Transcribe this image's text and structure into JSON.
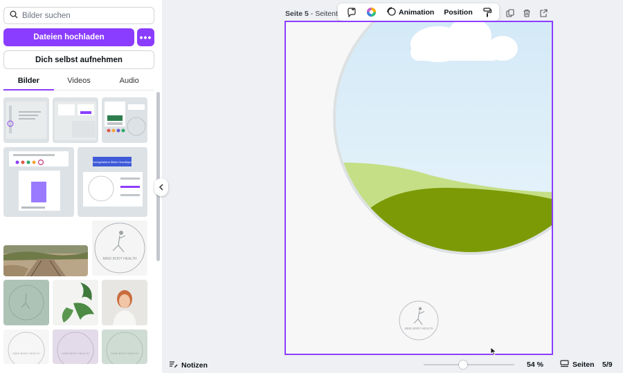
{
  "sidebar": {
    "search_placeholder": "Bilder suchen",
    "upload_label": "Dateien hochladen",
    "more_label": "•••",
    "record_label": "Dich selbst aufnehmen",
    "tabs": [
      {
        "label": "Bilder",
        "active": true
      },
      {
        "label": "Videos",
        "active": false
      },
      {
        "label": "Audio",
        "active": false
      }
    ],
    "thumb_button_label": "Hochgeladene Bilder hinzufügen",
    "thumb_logo_text": "MIND BODY HEALTH"
  },
  "canvas": {
    "page_label_bold": "Seite 5",
    "page_label_rest": " - Seitentit",
    "toolbar": {
      "animation_label": "Animation",
      "position_label": "Position"
    },
    "logo_text": "MIND BODY HEALTH"
  },
  "bottom_bar": {
    "notes_label": "Notizen",
    "zoom_label": "54 %",
    "pages_label": "Seiten",
    "pages_count": "5/9"
  },
  "colors": {
    "accent": "#8b3dff",
    "sky": "#cfe7f6",
    "light_green": "#c5df86",
    "dark_green": "#7c9a06"
  },
  "icons": [
    "search-icon",
    "more-icon",
    "collapse-chevron-icon",
    "comment-plus-icon",
    "color-wheel-icon",
    "animation-icon",
    "paint-roller-icon",
    "duplicate-icon",
    "trash-icon",
    "share-icon",
    "notes-icon",
    "pages-icon",
    "cursor-icon"
  ]
}
